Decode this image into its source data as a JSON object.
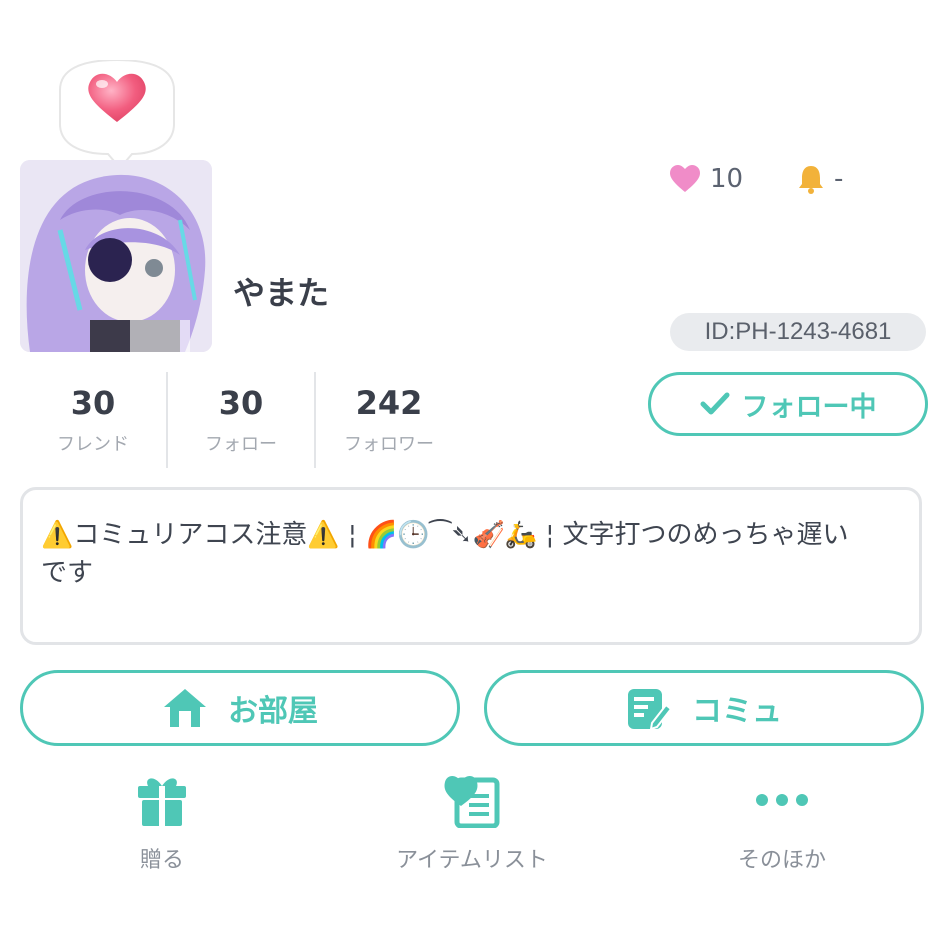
{
  "profile": {
    "username": "やまた",
    "likes_count": "10",
    "notification_value": "-",
    "id_label": "ID:PH-1243-4681"
  },
  "stats": [
    {
      "value": "30",
      "label": "フレンド"
    },
    {
      "value": "30",
      "label": "フォロー"
    },
    {
      "value": "242",
      "label": "フォロワー"
    }
  ],
  "follow_button": {
    "label": "フォロー中"
  },
  "bio": {
    "line1": "⚠️コミュリアコス注意⚠️ ¦ 🌈🕒⁀➴🎻🛵 ¦ 文字打つのめっちゃ遅い",
    "line2": "です"
  },
  "actions": {
    "room_label": "お部屋",
    "community_label": "コミュ"
  },
  "bottom_nav": {
    "gift_label": "贈る",
    "itemlist_label": "アイテムリスト",
    "more_label": "そのほか"
  },
  "colors": {
    "accent": "#4fc7b6",
    "heart": "#f06b8a",
    "bell": "#f2b23a"
  }
}
